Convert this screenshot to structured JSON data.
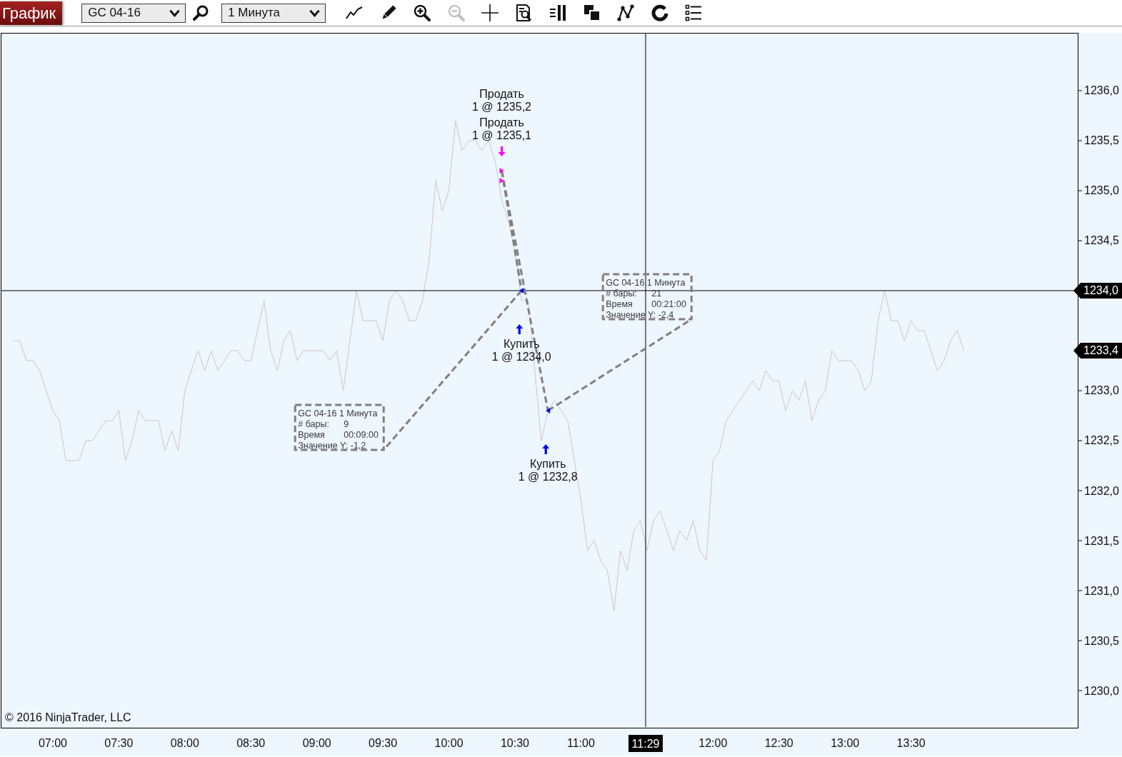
{
  "toolbar": {
    "tab": {
      "label": "График",
      "selected": true
    },
    "instrument": "GC 04-16",
    "interval": "1 Минута",
    "tools": [
      {
        "kind": "line",
        "disabled": false
      },
      {
        "kind": "pencil",
        "disabled": false
      },
      {
        "kind": "zoom-in",
        "disabled": false
      },
      {
        "kind": "zoom-out",
        "disabled": true
      },
      {
        "kind": "crosshair",
        "disabled": false
      },
      {
        "kind": "data-box",
        "disabled": false
      },
      {
        "kind": "bar-spacing",
        "disabled": false
      },
      {
        "kind": "squares",
        "disabled": false
      },
      {
        "kind": "nodes",
        "disabled": false
      },
      {
        "kind": "ring",
        "disabled": false
      },
      {
        "kind": "list",
        "disabled": false
      }
    ]
  },
  "chart": {
    "chart_data": [
      {
        "type": "line",
        "xlim": [
          6.611,
          14.757
        ],
        "ylim": [
          1229.636,
          1236.571
        ],
        "xticks": [
          {
            "value": 7,
            "label": "07:00"
          },
          {
            "value": 7.5,
            "label": "07:30"
          },
          {
            "value": 8,
            "label": "08:00"
          },
          {
            "value": 8.5,
            "label": "08:30"
          },
          {
            "value": 9,
            "label": "09:00"
          },
          {
            "value": 9.5,
            "label": "09:30"
          },
          {
            "value": 10,
            "label": "10:00"
          },
          {
            "value": 10.5,
            "label": "10:30"
          },
          {
            "value": 11,
            "label": "11:00"
          },
          {
            "value": 12,
            "label": "12:00"
          },
          {
            "value": 12.5,
            "label": "12:30"
          },
          {
            "value": 13,
            "label": "13:00"
          },
          {
            "value": 13.5,
            "label": "13:30"
          }
        ],
        "yticks": [
          {
            "value": 1236,
            "label": "1236,0"
          },
          {
            "value": 1235.5,
            "label": "1235,5"
          },
          {
            "value": 1235,
            "label": "1235,0"
          },
          {
            "value": 1234.5,
            "label": "1234,5"
          },
          {
            "value": 1233,
            "label": "1233,0"
          },
          {
            "value": 1232.5,
            "label": "1232,5"
          },
          {
            "value": 1232,
            "label": "1232,0"
          },
          {
            "value": 1231.5,
            "label": "1231,5"
          },
          {
            "value": 1231,
            "label": "1231,0"
          },
          {
            "value": 1230.5,
            "label": "1230,5"
          },
          {
            "value": 1230,
            "label": "1230,0"
          }
        ],
        "ref_lines": [
          {
            "axis": "x",
            "value": 11.49,
            "label": "11:29",
            "color": "#000000"
          },
          {
            "axis": "y",
            "value": 1234.0,
            "label": "1234,0",
            "color": "#000000"
          }
        ],
        "series": [
          {
            "type": "line",
            "color": "#c8c8c8",
            "x": [
              6.7,
              6.75,
              6.8,
              6.85,
              6.9,
              6.95,
              7,
              7.05,
              7.1,
              7.15,
              7.2,
              7.25,
              7.3,
              7.35,
              7.4,
              7.45,
              7.5,
              7.55,
              7.6,
              7.65,
              7.7,
              7.75,
              7.8,
              7.85,
              7.9,
              7.95,
              8,
              8.05,
              8.1,
              8.15,
              8.2,
              8.25,
              8.3,
              8.35,
              8.4,
              8.45,
              8.5,
              8.55,
              8.6,
              8.65,
              8.7,
              8.75,
              8.8,
              8.85,
              8.9,
              8.95,
              9,
              9.05,
              9.1,
              9.15,
              9.2,
              9.25,
              9.3,
              9.35,
              9.4,
              9.45,
              9.5,
              9.55,
              9.6,
              9.65,
              9.7,
              9.75,
              9.8,
              9.85,
              9.9,
              9.95,
              10,
              10.05,
              10.1,
              10.15,
              10.2,
              10.25,
              10.3,
              10.35,
              10.4,
              10.45,
              10.5,
              10.55,
              10.6,
              10.65,
              10.7,
              10.75,
              10.8,
              10.85,
              10.9,
              10.95,
              11,
              11.05,
              11.1,
              11.15,
              11.2,
              11.25,
              11.3,
              11.35,
              11.4,
              11.45,
              11.5,
              11.55,
              11.6,
              11.65,
              11.7,
              11.75,
              11.8,
              11.85,
              11.9,
              11.95,
              12,
              12.05,
              12.1,
              12.15,
              12.2,
              12.25,
              12.3,
              12.35,
              12.4,
              12.45,
              12.5,
              12.55,
              12.6,
              12.65,
              12.7,
              12.75,
              12.8,
              12.85,
              12.9,
              12.95,
              13,
              13.05,
              13.1,
              13.15,
              13.2,
              13.25,
              13.3,
              13.35,
              13.4,
              13.45,
              13.5,
              13.55,
              13.6,
              13.65,
              13.7,
              13.75,
              13.8,
              13.85,
              13.9
            ],
            "values": [
              1233.5,
              1233.5,
              1233.3,
              1233.3,
              1233.2,
              1233.0,
              1232.8,
              1232.7,
              1232.3,
              1232.3,
              1232.3,
              1232.5,
              1232.5,
              1232.6,
              1232.7,
              1232.7,
              1232.8,
              1232.3,
              1232.5,
              1232.8,
              1232.7,
              1232.7,
              1232.7,
              1232.4,
              1232.6,
              1232.4,
              1233.0,
              1233.2,
              1233.4,
              1233.2,
              1233.4,
              1233.2,
              1233.3,
              1233.4,
              1233.4,
              1233.3,
              1233.3,
              1233.6,
              1233.9,
              1233.4,
              1233.2,
              1233.5,
              1233.6,
              1233.3,
              1233.4,
              1233.4,
              1233.4,
              1233.4,
              1233.3,
              1233.4,
              1233.0,
              1233.5,
              1234.0,
              1233.7,
              1233.7,
              1233.7,
              1233.5,
              1233.9,
              1234.0,
              1233.9,
              1233.7,
              1233.7,
              1233.9,
              1234.3,
              1235.1,
              1234.8,
              1235.0,
              1235.7,
              1235.4,
              1235.5,
              1235.5,
              1235.4,
              1235.5,
              1235.3,
              1234.9,
              1234.7,
              1234.4,
              1233.9,
              1233.9,
              1233.2,
              1232.5,
              1232.8,
              1232.9,
              1232.8,
              1232.7,
              1232.3,
              1231.9,
              1231.4,
              1231.5,
              1231.3,
              1231.2,
              1230.8,
              1231.4,
              1231.2,
              1231.6,
              1231.7,
              1231.4,
              1231.7,
              1231.8,
              1231.6,
              1231.4,
              1231.6,
              1231.5,
              1231.7,
              1231.4,
              1231.3,
              1232.3,
              1232.4,
              1232.7,
              1232.8,
              1232.9,
              1233.0,
              1233.1,
              1233.0,
              1233.2,
              1233.1,
              1233.1,
              1232.8,
              1233.0,
              1232.9,
              1233.1,
              1232.7,
              1232.9,
              1233.0,
              1233.4,
              1233.3,
              1233.3,
              1233.3,
              1233.2,
              1233.0,
              1233.1,
              1233.7,
              1234.0,
              1233.7,
              1233.7,
              1233.5,
              1233.7,
              1233.6,
              1233.6,
              1233.4,
              1233.2,
              1233.3,
              1233.5,
              1233.6,
              1233.4
            ]
          },
          {
            "type": "scatter",
            "marker": "triangle-right",
            "color": "#ff00ff",
            "x": [
              10.4,
              10.4
            ],
            "values": [
              1235.2,
              1235.1
            ]
          },
          {
            "type": "scatter",
            "marker": "triangle-left",
            "color": "#0000ff",
            "x": [
              10.55,
              10.75
            ],
            "values": [
              1234.0,
              1232.8
            ]
          },
          {
            "type": "line",
            "line_style": "dashed",
            "color": "#808080",
            "x": [
              10.4,
              10.55
            ],
            "values": [
              1235.2,
              1234.0
            ]
          },
          {
            "type": "line",
            "line_style": "dashed",
            "color": "#808080",
            "x": [
              10.4,
              10.75
            ],
            "values": [
              1235.2,
              1232.8
            ]
          }
        ]
      }
    ],
    "last_price": {
      "label": "1233,4"
    },
    "executions": [
      {
        "kind": "sell",
        "action": "Продать",
        "detail": "1 @ 1235,2"
      },
      {
        "kind": "sell",
        "action": "Продать",
        "detail": "1 @ 1235,1"
      },
      {
        "kind": "buy",
        "action": "Купить",
        "detail": "1 @ 1234,0"
      },
      {
        "kind": "buy",
        "action": "Купить",
        "detail": "1 @ 1232,8"
      }
    ],
    "rulers": [
      {
        "title": "GC 04-16 1 Минута",
        "bars_label": "# бары:",
        "bars": "9",
        "duration_label": "Время",
        "duration": "00:09:00",
        "value_label": "Значение Y:",
        "value": "-1,2"
      },
      {
        "title": "GC 04-16 1 Минута",
        "bars_label": "# бары:",
        "bars": "21",
        "duration_label": "Время",
        "duration": "00:21:00",
        "value_label": "Значение Y:",
        "value": "-2,4"
      }
    ],
    "copyright": "© 2016 NinjaTrader, LLC"
  }
}
